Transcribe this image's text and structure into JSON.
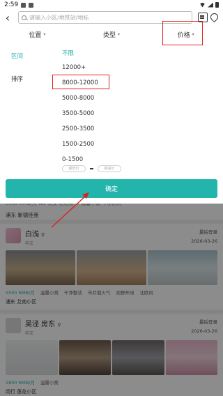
{
  "status_bar": {
    "time": "2:59"
  },
  "search": {
    "placeholder": "请输入小区/地铁站/地标"
  },
  "filters": {
    "location": "位置",
    "type": "类型",
    "price": "价格"
  },
  "panel": {
    "range_label": "区间",
    "sort_label": "排序",
    "options": [
      "不限",
      "12000+",
      "8000-12000",
      "5000-8000",
      "3500-5000",
      "2500-3500",
      "1500-2500",
      "0-1500"
    ],
    "selected_option": "不限",
    "min_placeholder": "最低价",
    "max_placeholder": "最高价",
    "confirm_label": "确定"
  },
  "listing_prev": {
    "summary": "5500 RMB/月  NO 公交  近地铁  ☆  温馨小窝  干净房间",
    "location": "浦东 新德佳苑"
  },
  "listing1": {
    "name": "白浅",
    "lang": "中文",
    "last_login_label": "最后登录",
    "date": "2026-03-26",
    "price": "5500 RMB/月",
    "tags": [
      "温馨小窝",
      "干净整洁",
      "市井烟火气",
      "视野开阔",
      "北欧风"
    ],
    "location": "浦东 艾南小区"
  },
  "listing2": {
    "name": "吴泾 房东",
    "lang": "中文",
    "last_login_label": "最后登录",
    "date": "2026-03-26",
    "price": "2800 RMB/月",
    "tags": [
      "温馨小窝"
    ],
    "location": "闵行 莲花小区"
  },
  "colors": {
    "accent": "#23b4ac",
    "highlight": "#e02020"
  }
}
